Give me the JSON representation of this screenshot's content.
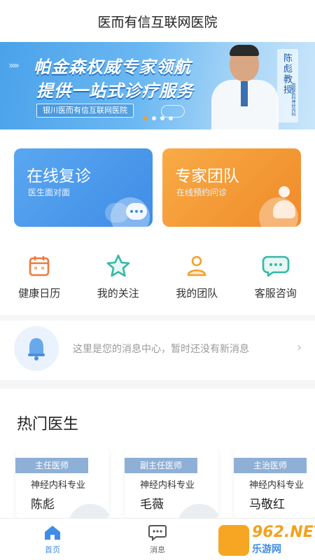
{
  "app": {
    "title": "医而有信互联网医院"
  },
  "banner": {
    "line1": "帕金森权威专家领航",
    "line2": "提供一站式诊疗服务",
    "hospital": "银川医而有信互联网医院",
    "doctor_name": "陈彪教授",
    "doctor_dept": "首都医科神经内科",
    "slides": 4,
    "active_slide": 0
  },
  "cards": [
    {
      "title": "在线复诊",
      "subtitle": "医生面对面",
      "color": "#4a97ec"
    },
    {
      "title": "专家团队",
      "subtitle": "在线预约问诊",
      "color": "#f39a36"
    }
  ],
  "quick_actions": [
    {
      "label": "健康日历",
      "icon": "calendar-icon",
      "color": "#f07a3a"
    },
    {
      "label": "我的关注",
      "icon": "star-icon",
      "color": "#35b8a6"
    },
    {
      "label": "我的团队",
      "icon": "team-icon",
      "color": "#f2a12a"
    },
    {
      "label": "客服咨询",
      "icon": "chat-icon",
      "color": "#35b8a6"
    }
  ],
  "message_center": {
    "text": "这里是您的消息中心，暂时还没有新消息"
  },
  "hot_doctors": {
    "title": "热门医生",
    "list": [
      {
        "title": "主任医师",
        "specialty": "神经内科专业",
        "name": "陈彪"
      },
      {
        "title": "副主任医师",
        "specialty": "神经内科专业",
        "name": "毛薇"
      },
      {
        "title": "主治医师",
        "specialty": "神经内科专业",
        "name": "马敬红"
      }
    ]
  },
  "tabbar": [
    {
      "label": "首页",
      "icon": "home-icon",
      "active": true
    },
    {
      "label": "消息",
      "icon": "message-icon",
      "active": false
    }
  ],
  "watermark": {
    "brand": "962.NET",
    "sub": "乐游网"
  }
}
